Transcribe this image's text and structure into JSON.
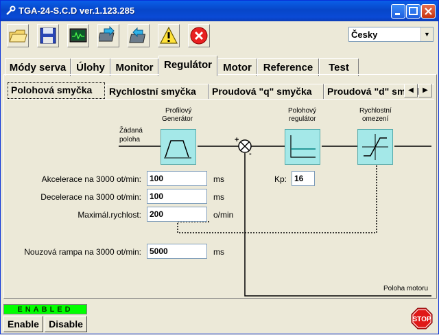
{
  "window": {
    "title": "TGA-24-S.C.D  ver.1.123.285"
  },
  "toolbar": {
    "icons": [
      "open-folder-icon",
      "save-disk-icon",
      "monitor-icon",
      "download-chip-icon",
      "upload-chip-icon",
      "warning-icon",
      "error-icon"
    ]
  },
  "language": {
    "selected": "Česky"
  },
  "main_tabs": [
    "Módy serva",
    "Úlohy",
    "Monitor",
    "Regulátor",
    "Motor",
    "Reference",
    "Test"
  ],
  "active_main_tab": "Regulátor",
  "sub_tabs": [
    "Polohová smyčka",
    "Rychlostní smyčka",
    "Proudová \"q\" smyčka",
    "Proudová \"d\" smyčka"
  ],
  "active_sub_tab": "Polohová smyčka",
  "diagram": {
    "input_label_line1": "Žádaná",
    "input_label_line2": "poloha",
    "block1_line1": "Profilový",
    "block1_line2": "Generátor",
    "block2_line1": "Polohový",
    "block2_line2": "regulátor",
    "block3_line1": "Rychlostní",
    "block3_line2": "omezení",
    "feedback_label": "Poloha motoru",
    "sum_plus": "+",
    "sum_minus": "-"
  },
  "params": [
    {
      "label": "Akcelerace na 3000 ot/min:",
      "value": "100",
      "unit": "ms"
    },
    {
      "label": "Decelerace na 3000 ot/min:",
      "value": "100",
      "unit": "ms"
    },
    {
      "label": "Maximál.rychlost:",
      "value": "200",
      "unit": "o/min"
    },
    {
      "label": "Nouzová rampa na 3000 ot/min:",
      "value": "5000",
      "unit": "ms"
    }
  ],
  "kp": {
    "label": "Kp:",
    "value": "16"
  },
  "status": {
    "text": "ENABLED",
    "color": "#00ff00"
  },
  "buttons": {
    "enable": "Enable",
    "disable": "Disable",
    "stop": "STOP"
  }
}
